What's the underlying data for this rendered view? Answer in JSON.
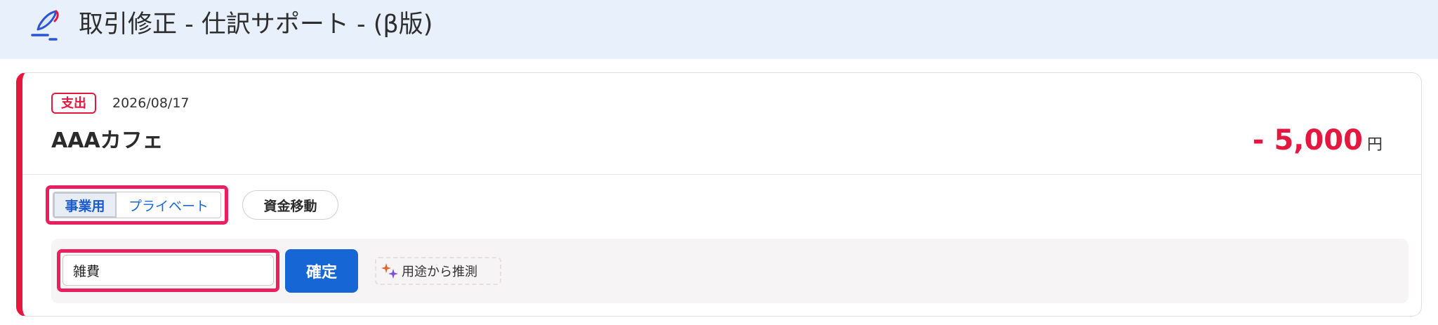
{
  "header": {
    "title": "取引修正 - 仕訳サポート - (β版)",
    "logo_icon": "quill-pen-icon"
  },
  "transaction": {
    "type_badge": "支出",
    "date": "2026/08/17",
    "merchant": "AAAカフェ",
    "amount": "- 5,000",
    "currency_unit": "円"
  },
  "classification": {
    "business_label": "事業用",
    "private_label": "プライベート",
    "selected": "事業用",
    "transfer_label": "資金移動"
  },
  "account": {
    "value": "雑費",
    "confirm_label": "確定",
    "suggest_label": "用途から推測",
    "suggest_icon": "sparkle-icon"
  },
  "colors": {
    "header_bg": "#e8f0fc",
    "expense_red": "#e5173f",
    "primary_blue": "#1766d6",
    "highlight_pink": "#ea1f5f"
  }
}
